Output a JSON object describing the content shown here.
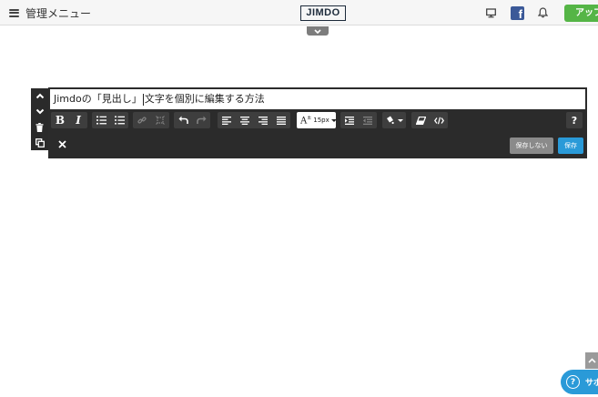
{
  "topbar": {
    "menu_label": "管理メニュー",
    "logo_text": "JIMDO",
    "upgrade_label": "アップ",
    "facebook_glyph": "f",
    "icons": [
      "hamburger-icon",
      "monitor-icon",
      "facebook-icon",
      "bell-icon",
      "chevron-down-icon"
    ]
  },
  "editor": {
    "heading_before": "Jimdoの「見出し」",
    "heading_after": "文字を個別に編集する方法",
    "font_size": "15px",
    "help_label": "?",
    "cancel_label": "保存しない",
    "save_label": "保存"
  },
  "support": {
    "label": "サポ"
  },
  "colors": {
    "upgrade_green": "#55b546",
    "facebook_blue": "#3b5998",
    "save_blue": "#2a9ad8",
    "editor_dark": "#2b2b2b",
    "cancel_gray": "#8a8a8a"
  }
}
